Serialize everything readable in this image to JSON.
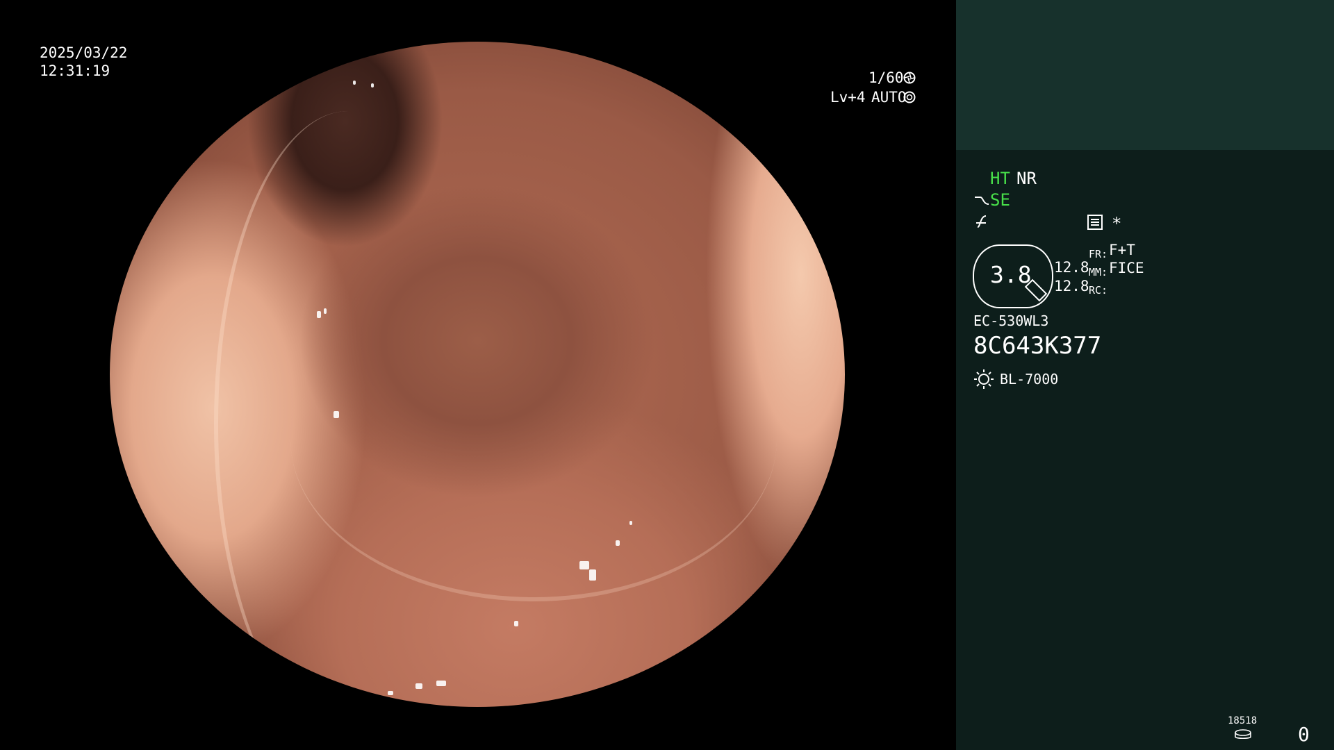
{
  "overlay": {
    "date": "2025/03/22",
    "time": "12:31:19",
    "shutter": "1/60",
    "level": "Lv+4",
    "mode": "AUTO"
  },
  "panel": {
    "ht": "HT",
    "nr": "NR",
    "se": "SE",
    "asterisk": "*",
    "zoom": "3.8",
    "val1": "12.8",
    "val2": "12.8",
    "fr_label": "FR:",
    "fr_value": "F+T",
    "mm_label": "MM:",
    "mm_value": "FICE",
    "rc_label": "RC:",
    "scope_model": "EC-530WL3",
    "serial": "8C643K377",
    "light_source": "BL-7000",
    "storage_count": "18518",
    "counter": "0"
  },
  "icons": {
    "shutter": "aperture-icon",
    "mode": "auto-iris-icon",
    "se": "curve-icon",
    "f": "f-curve-icon",
    "settings": "list-icon",
    "light": "sun-icon",
    "storage": "disk-icon"
  },
  "colors": {
    "accent_green": "#48e04a",
    "panel_bg": "#0d1e1b",
    "panel_top": "#17312c"
  }
}
